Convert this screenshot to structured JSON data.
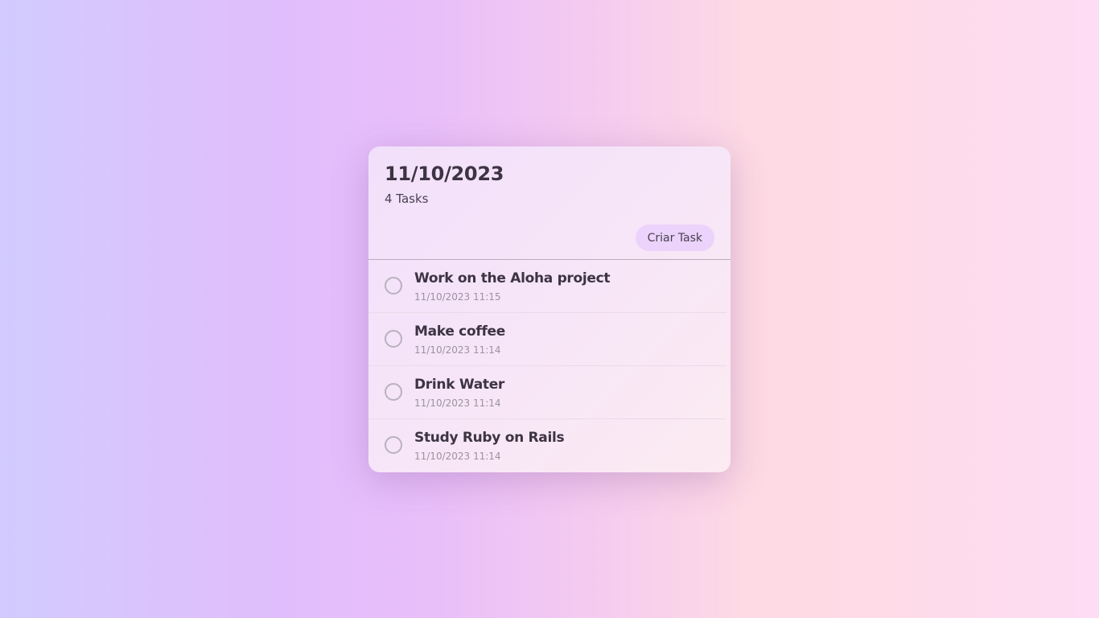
{
  "header": {
    "date": "11/10/2023",
    "task_count": "4 Tasks",
    "create_label": "Criar Task"
  },
  "tasks": [
    {
      "title": "Work on the Aloha project",
      "timestamp": "11/10/2023 11:15",
      "done": false
    },
    {
      "title": "Make coffee",
      "timestamp": "11/10/2023 11:14",
      "done": false
    },
    {
      "title": "Drink Water",
      "timestamp": "11/10/2023 11:14",
      "done": false
    },
    {
      "title": "Study Ruby on Rails",
      "timestamp": "11/10/2023 11:14",
      "done": false
    }
  ],
  "colors": {
    "text_primary": "#3d3443",
    "button_bg": "#ebd3fb",
    "checkbox_border": "#b9b1bd"
  }
}
